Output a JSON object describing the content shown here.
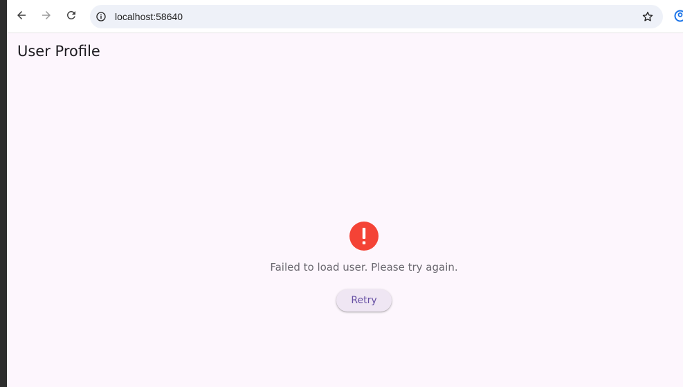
{
  "browser": {
    "url": "localhost:58640",
    "icons": {
      "back": "arrow-left-icon",
      "forward": "arrow-right-icon",
      "reload": "reload-icon",
      "site_info": "info-circle-icon",
      "bookmark": "star-icon",
      "profile": "profile-icon"
    }
  },
  "app": {
    "title": "User Profile"
  },
  "error": {
    "icon": "error-exclamation-icon",
    "icon_color": "#f44336",
    "message": "Failed to load user. Please try again.",
    "retry_label": "Retry"
  },
  "colors": {
    "page_background": "#fdf6fd",
    "button_text": "#6750a4",
    "button_background": "#efe6f3"
  }
}
